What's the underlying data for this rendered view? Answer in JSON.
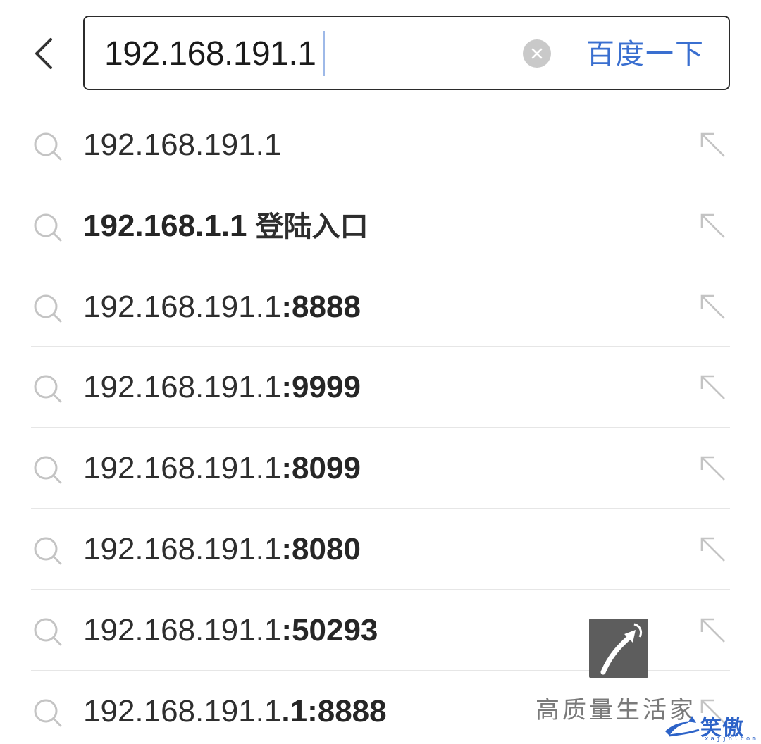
{
  "header": {
    "back_icon": "chevron-left-icon",
    "search_value": "192.168.191.1",
    "clear_icon": "clear-circle-icon",
    "search_button_label": "百度一下"
  },
  "suggestions": [
    {
      "prefix": "192.168.191.1",
      "bold": "",
      "cjk": ""
    },
    {
      "prefix": "",
      "bold": "192.168.1.1 ",
      "cjk": "登陆入口"
    },
    {
      "prefix": "192.168.191.1",
      "bold": ":8888",
      "cjk": ""
    },
    {
      "prefix": "192.168.191.1",
      "bold": ":9999",
      "cjk": ""
    },
    {
      "prefix": "192.168.191.1",
      "bold": ":8099",
      "cjk": ""
    },
    {
      "prefix": "192.168.191.1",
      "bold": ":8080",
      "cjk": ""
    },
    {
      "prefix": "192.168.191.1",
      "bold": ":50293",
      "cjk": ""
    },
    {
      "prefix": "192.168.191.1",
      "bold": ".1:8888",
      "cjk": ""
    }
  ],
  "watermark": {
    "text": "高质量生活家",
    "site_name": "笑傲网",
    "site_domain": "xajjn.com"
  },
  "colors": {
    "accent": "#3a6fd0",
    "text": "#2e2e2e",
    "icon_gray": "#c4c4c4"
  }
}
